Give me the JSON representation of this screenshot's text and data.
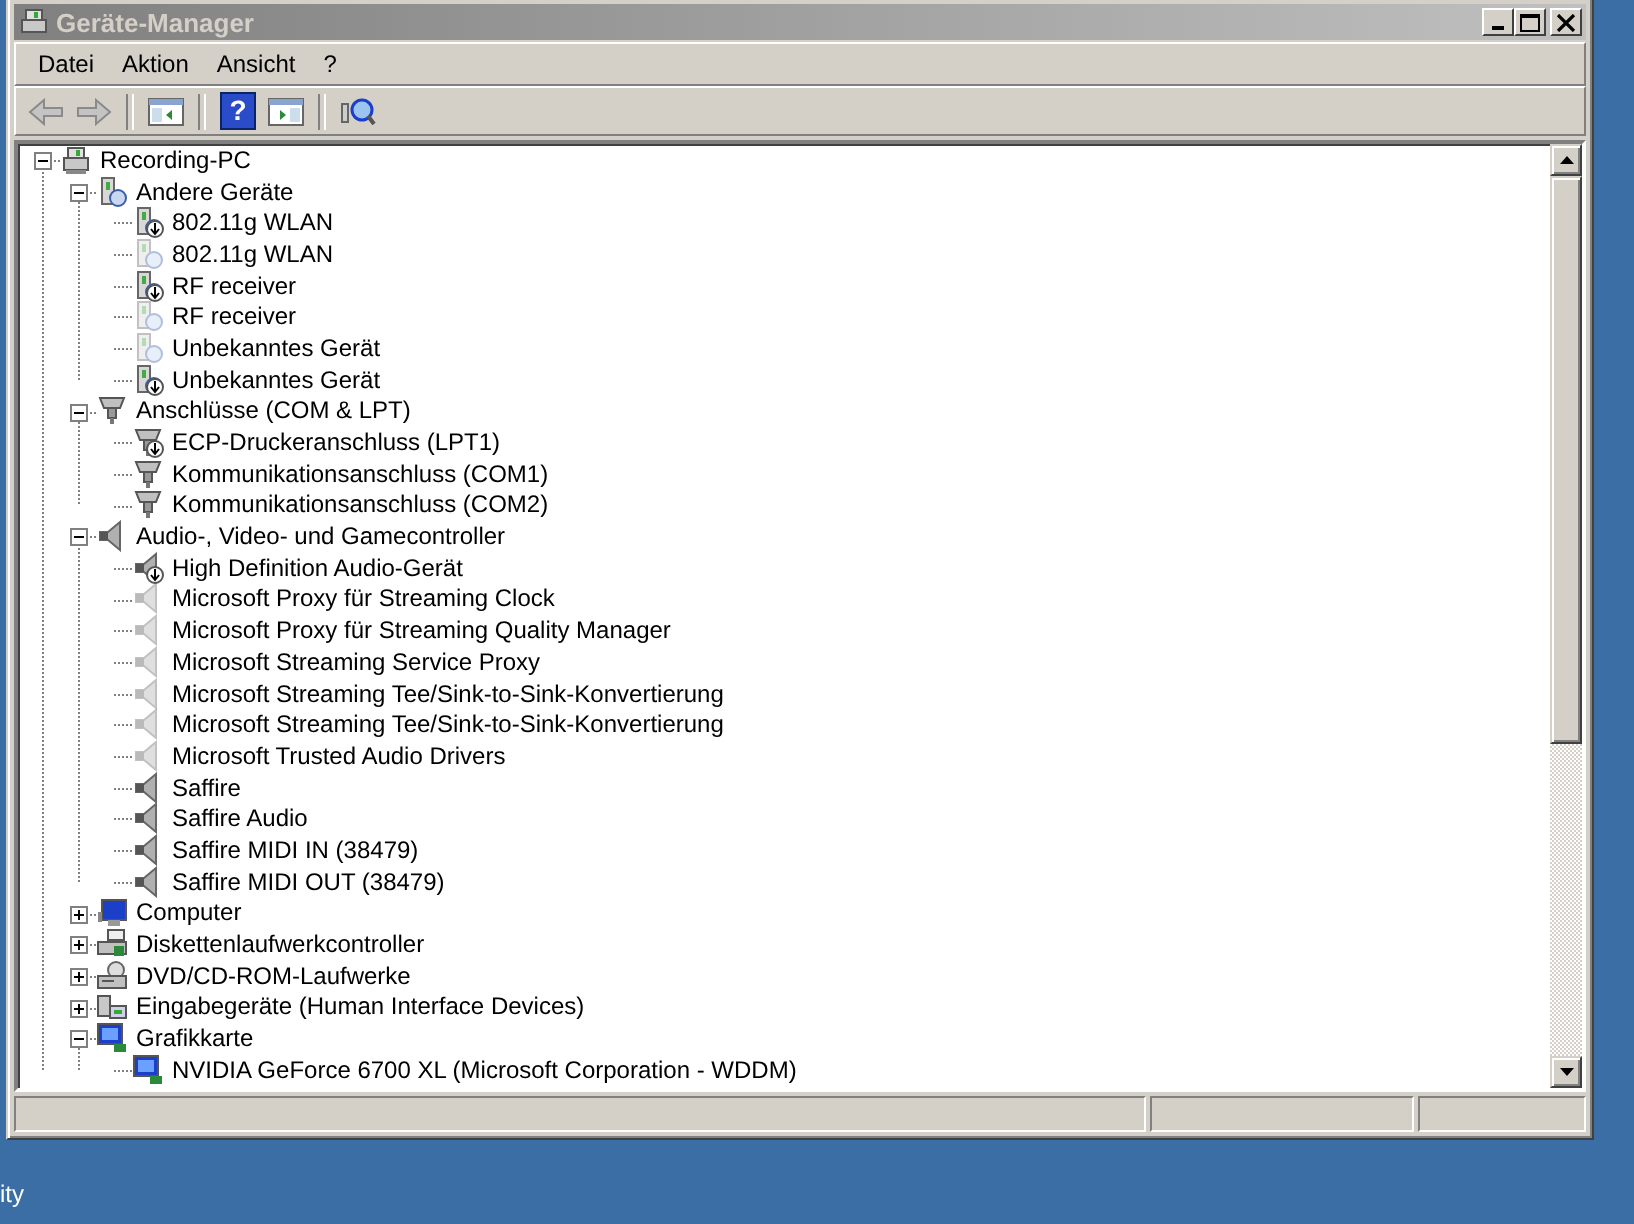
{
  "window": {
    "title": "Geräte-Manager",
    "active": false
  },
  "menu": [
    "Datei",
    "Aktion",
    "Ansicht",
    "?"
  ],
  "toolbar": [
    {
      "kind": "back",
      "disabled": true
    },
    {
      "kind": "forward",
      "disabled": true
    },
    {
      "kind": "separator"
    },
    {
      "kind": "console-tree"
    },
    {
      "kind": "separator"
    },
    {
      "kind": "help",
      "glyph": "?"
    },
    {
      "kind": "properties"
    },
    {
      "kind": "separator"
    },
    {
      "kind": "scan"
    }
  ],
  "tree": {
    "label": "Recording-PC",
    "kind": "computer",
    "expanded": true,
    "children": [
      {
        "label": "Andere Geräte",
        "kind": "unknown",
        "expanded": true,
        "children": [
          {
            "label": "802.11g WLAN",
            "problem": true,
            "hidden": false
          },
          {
            "label": "802.11g WLAN",
            "problem": false,
            "hidden": true
          },
          {
            "label": "RF receiver",
            "problem": true,
            "hidden": false
          },
          {
            "label": "RF receiver",
            "problem": false,
            "hidden": true
          },
          {
            "label": "Unbekanntes Gerät",
            "problem": false,
            "hidden": true
          },
          {
            "label": "Unbekanntes Gerät",
            "problem": true,
            "hidden": false
          }
        ]
      },
      {
        "label": "Anschlüsse (COM & LPT)",
        "kind": "port",
        "expanded": true,
        "children": [
          {
            "label": "ECP-Druckeranschluss (LPT1)",
            "problem": true,
            "hidden": false
          },
          {
            "label": "Kommunikationsanschluss (COM1)",
            "problem": false,
            "hidden": false
          },
          {
            "label": "Kommunikationsanschluss (COM2)",
            "problem": false,
            "hidden": false
          }
        ]
      },
      {
        "label": "Audio-, Video- und Gamecontroller",
        "kind": "audio",
        "expanded": true,
        "children": [
          {
            "label": "High Definition Audio-Gerät",
            "problem": true,
            "hidden": false
          },
          {
            "label": "Microsoft Proxy für Streaming Clock",
            "problem": false,
            "hidden": true
          },
          {
            "label": "Microsoft Proxy für Streaming Quality Manager",
            "problem": false,
            "hidden": true
          },
          {
            "label": "Microsoft Streaming Service Proxy",
            "problem": false,
            "hidden": true
          },
          {
            "label": "Microsoft Streaming Tee/Sink-to-Sink-Konvertierung",
            "problem": false,
            "hidden": true
          },
          {
            "label": "Microsoft Streaming Tee/Sink-to-Sink-Konvertierung",
            "problem": false,
            "hidden": true
          },
          {
            "label": "Microsoft Trusted Audio Drivers",
            "problem": false,
            "hidden": true
          },
          {
            "label": "Saffire",
            "problem": false,
            "hidden": false
          },
          {
            "label": "Saffire Audio",
            "problem": false,
            "hidden": false
          },
          {
            "label": "Saffire MIDI IN (38479)",
            "problem": false,
            "hidden": false
          },
          {
            "label": "Saffire MIDI OUT (38479)",
            "problem": false,
            "hidden": false
          }
        ]
      },
      {
        "label": "Computer",
        "kind": "monitor",
        "expanded": false
      },
      {
        "label": "Diskettenlaufwerkcontroller",
        "kind": "floppy",
        "expanded": false
      },
      {
        "label": "DVD/CD-ROM-Laufwerke",
        "kind": "dvd",
        "expanded": false
      },
      {
        "label": "Eingabegeräte (Human Interface Devices)",
        "kind": "hid",
        "expanded": false
      },
      {
        "label": "Grafikkarte",
        "kind": "display",
        "expanded": true,
        "children": [
          {
            "label": "NVIDIA GeForce 6700 XL (Microsoft Corporation - WDDM)",
            "problem": false,
            "hidden": false
          }
        ]
      }
    ]
  },
  "desktop": {
    "icon_labels": [
      "ity"
    ]
  }
}
